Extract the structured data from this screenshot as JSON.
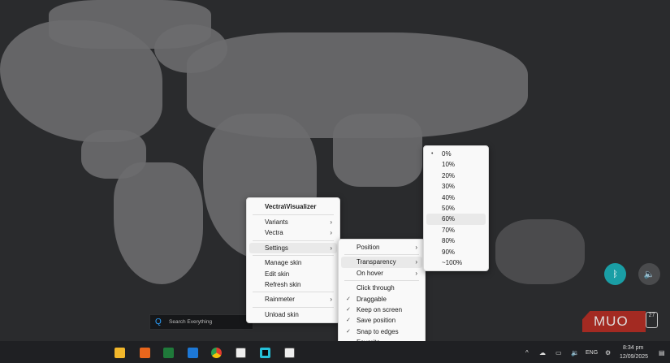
{
  "context_menu": {
    "title": "Vectra\\Visualizer",
    "items": [
      "Variants",
      "Vectra",
      "Settings",
      "Manage skin",
      "Edit skin",
      "Refresh skin",
      "Rainmeter",
      "Unload skin"
    ]
  },
  "settings_submenu": {
    "items": [
      "Position",
      "Transparency",
      "On hover",
      "Click through",
      "Draggable",
      "Keep on screen",
      "Save position",
      "Snap to edges",
      "Favorite"
    ],
    "checked": [
      false,
      false,
      false,
      false,
      true,
      true,
      true,
      true,
      false
    ]
  },
  "transparency_submenu": {
    "items": [
      "0%",
      "10%",
      "20%",
      "30%",
      "40%",
      "50%",
      "60%",
      "70%",
      "80%",
      "90%",
      "~100%"
    ],
    "selected": "0%",
    "highlighted": "60%"
  },
  "search": {
    "placeholder": "Search Everything"
  },
  "logo": {
    "text": "MUO",
    "badge": "27"
  },
  "taskbar": {
    "apps": [
      "file-explorer",
      "foxit",
      "excel-like",
      "dictionary",
      "chrome",
      "notion",
      "rainmeter",
      "notion"
    ],
    "language": "ENG",
    "time": "8:34 pm",
    "date": "12/09/2025"
  },
  "colors": {
    "accent": "#1a9ea5",
    "logo": "#a32a22"
  }
}
